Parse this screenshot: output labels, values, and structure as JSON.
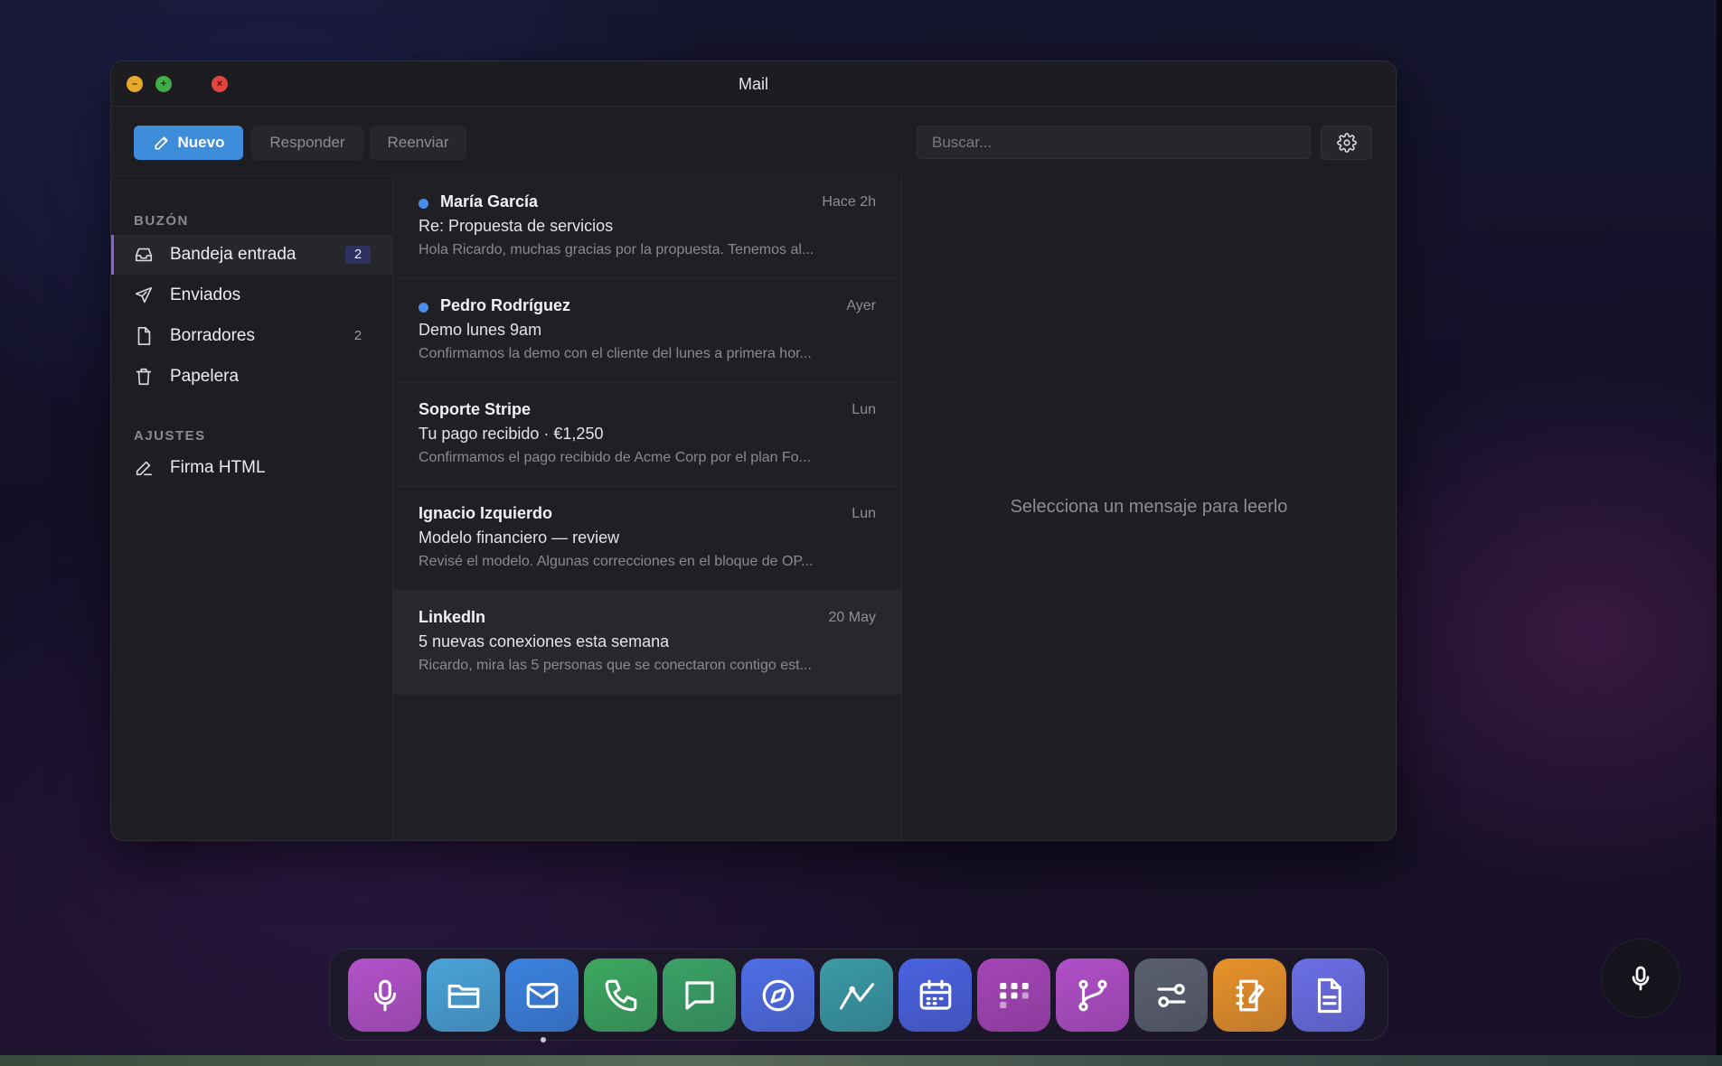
{
  "window": {
    "title": "Mail"
  },
  "toolbar": {
    "new_label": "Nuevo",
    "reply_label": "Responder",
    "forward_label": "Reenviar",
    "search_placeholder": "Buscar..."
  },
  "sidebar": {
    "mailbox_heading": "BUZÓN",
    "items": [
      {
        "label": "Bandeja entrada",
        "count": "2",
        "icon": "inbox-icon",
        "active": true
      },
      {
        "label": "Enviados",
        "count": "",
        "icon": "send-icon"
      },
      {
        "label": "Borradores",
        "count": "2",
        "icon": "file-icon"
      },
      {
        "label": "Papelera",
        "count": "",
        "icon": "trash-icon"
      }
    ],
    "settings_heading": "AJUSTES",
    "settings_items": [
      {
        "label": "Firma HTML",
        "icon": "pen-icon"
      }
    ]
  },
  "messages": [
    {
      "sender": "María García",
      "time": "Hace 2h",
      "subject": "Re: Propuesta de servicios",
      "preview": "Hola Ricardo, muchas gracias por la propuesta. Tenemos al...",
      "unread": true
    },
    {
      "sender": "Pedro Rodríguez",
      "time": "Ayer",
      "subject": "Demo lunes 9am",
      "preview": "Confirmamos la demo con el cliente del lunes a primera hor...",
      "unread": true
    },
    {
      "sender": "Soporte Stripe",
      "time": "Lun",
      "subject": "Tu pago recibido · €1,250",
      "preview": "Confirmamos el pago recibido de Acme Corp por el plan Fo...",
      "unread": false
    },
    {
      "sender": "Ignacio Izquierdo",
      "time": "Lun",
      "subject": "Modelo financiero — review",
      "preview": "Revisé el modelo. Algunas correcciones en el bloque de OP...",
      "unread": false
    },
    {
      "sender": "LinkedIn",
      "time": "20 May",
      "subject": "5 nuevas conexiones esta semana",
      "preview": "Ricardo, mira las 5 personas que se conectaron contigo est...",
      "unread": false
    }
  ],
  "reading_pane": {
    "empty_text": "Selecciona un mensaje para leerlo"
  },
  "dock": {
    "apps": [
      {
        "name": "voice-app",
        "icon": "microphone-icon",
        "color": "#b352c9"
      },
      {
        "name": "files-app",
        "icon": "folder-icon",
        "color": "#4aa3d8"
      },
      {
        "name": "mail-app",
        "icon": "envelope-icon",
        "color": "#3b82e0",
        "active": true
      },
      {
        "name": "phone-app",
        "icon": "phone-icon",
        "color": "#3ca860"
      },
      {
        "name": "messages-app",
        "icon": "chat-icon",
        "color": "#3aa265"
      },
      {
        "name": "browser-app",
        "icon": "compass-icon",
        "color": "#4f6ee6"
      },
      {
        "name": "analytics-app",
        "icon": "chart-line-icon",
        "color": "#3a9aa6"
      },
      {
        "name": "calendar-app",
        "icon": "calendar-icon",
        "color": "#4a62e0"
      },
      {
        "name": "board-app",
        "icon": "kanban-icon",
        "color": "#a645b8"
      },
      {
        "name": "git-app",
        "icon": "branch-icon",
        "color": "#b14fc8"
      },
      {
        "name": "settings-app",
        "icon": "sliders-icon",
        "color": "#5a5f6e"
      },
      {
        "name": "notes-app",
        "icon": "notebook-icon",
        "color": "#e8922a"
      },
      {
        "name": "docs-app",
        "icon": "document-icon",
        "color": "#6a6fe6"
      }
    ]
  },
  "colors": {
    "accent": "#3d8ddb",
    "active_indicator": "#8a62d8",
    "unread_dot": "#4a8de8"
  }
}
